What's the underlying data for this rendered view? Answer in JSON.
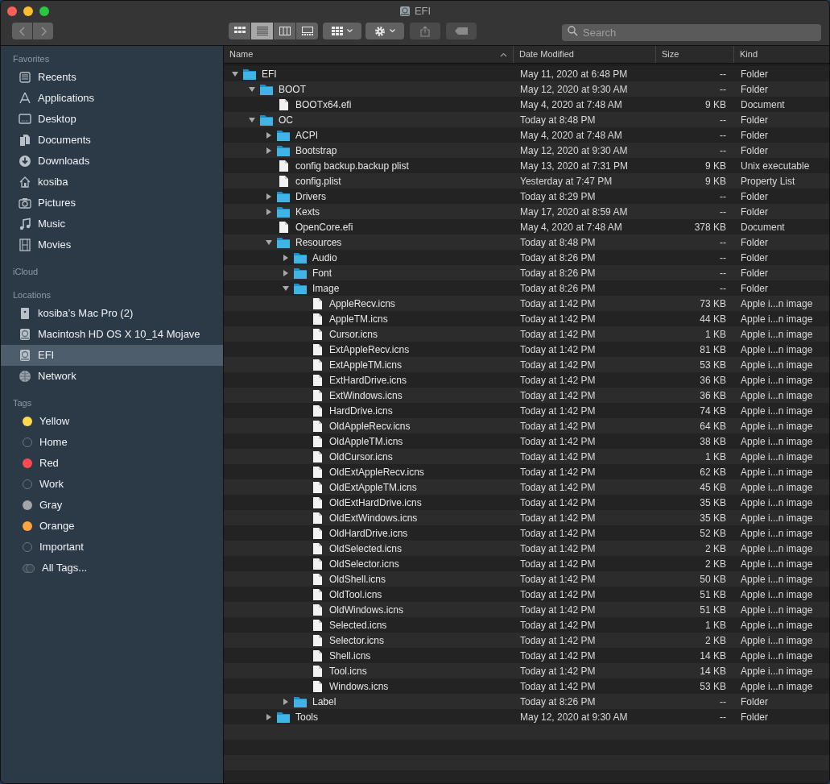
{
  "window": {
    "title": "EFI"
  },
  "toolbar": {
    "views": [
      {
        "selected": false
      },
      {
        "selected": true
      },
      {
        "selected": false
      },
      {
        "selected": false
      }
    ],
    "search": {
      "placeholder": "Search"
    }
  },
  "sidebar": {
    "sections": [
      {
        "heading": "Favorites",
        "items": [
          {
            "label": "Recents",
            "selected": false
          },
          {
            "label": "Applications",
            "selected": false
          },
          {
            "label": "Desktop",
            "selected": false
          },
          {
            "label": "Documents",
            "selected": false
          },
          {
            "label": "Downloads",
            "selected": false
          },
          {
            "label": "kosiba",
            "selected": false
          },
          {
            "label": "Pictures",
            "selected": false
          },
          {
            "label": "Music",
            "selected": false
          },
          {
            "label": "Movies",
            "selected": false
          }
        ]
      },
      {
        "heading": "iCloud"
      },
      {
        "heading": "Locations",
        "items": [
          {
            "label": "kosiba’s Mac Pro (2)",
            "selected": false
          },
          {
            "label": "Macintosh HD OS X 10_14 Mojave",
            "selected": false
          },
          {
            "label": "EFI",
            "selected": true
          },
          {
            "label": "Network",
            "selected": false
          }
        ]
      }
    ],
    "tags_heading": "Tags",
    "tags": [
      {
        "label": "Yellow",
        "kind": "tag",
        "color": "#fedb4d"
      },
      {
        "label": "Home",
        "kind": "tag"
      },
      {
        "label": "Red",
        "kind": "tag",
        "color": "#fd4a52"
      },
      {
        "label": "Work",
        "kind": "tag"
      },
      {
        "label": "Gray",
        "kind": "tag",
        "color": "#a5a5a8"
      },
      {
        "label": "Orange",
        "kind": "tag",
        "color": "#fea541"
      },
      {
        "label": "Important",
        "kind": "tag"
      },
      {
        "label": "All Tags...",
        "kind": "all"
      }
    ]
  },
  "table": {
    "columns": [
      "Name",
      "Date Modified",
      "Size",
      "Kind"
    ],
    "rows": [
      {
        "kind": "folder",
        "expanded": true,
        "name": "EFI",
        "date": "May 11, 2020 at 6:48 PM",
        "size": "--",
        "type": "Folder",
        "children": [
          {
            "kind": "folder",
            "expanded": true,
            "name": "BOOT",
            "date": "May 12, 2020 at 9:30 AM",
            "size": "--",
            "type": "Folder",
            "children": [
              {
                "kind": "file",
                "name": "BOOTx64.efi",
                "date": "May 4, 2020 at 7:48 AM",
                "size": "9 KB",
                "type": "Document"
              }
            ]
          },
          {
            "kind": "folder",
            "expanded": true,
            "name": "OC",
            "date": "Today at 8:48 PM",
            "size": "--",
            "type": "Folder",
            "children": [
              {
                "kind": "folder",
                "expanded": false,
                "name": "ACPI",
                "date": "May 4, 2020 at 7:48 AM",
                "size": "--",
                "type": "Folder"
              },
              {
                "kind": "folder",
                "expanded": false,
                "name": "Bootstrap",
                "date": "May 12, 2020 at 9:30 AM",
                "size": "--",
                "type": "Folder"
              },
              {
                "kind": "file",
                "name": "config backup.backup plist",
                "date": "May 13, 2020 at 7:31 PM",
                "size": "9 KB",
                "type": "Unix executable"
              },
              {
                "kind": "file",
                "name": "config.plist",
                "date": "Yesterday at 7:47 PM",
                "size": "9 KB",
                "type": "Property List"
              },
              {
                "kind": "folder",
                "expanded": false,
                "name": "Drivers",
                "date": "Today at 8:29 PM",
                "size": "--",
                "type": "Folder"
              },
              {
                "kind": "folder",
                "expanded": false,
                "name": "Kexts",
                "date": "May 17, 2020 at 8:59 AM",
                "size": "--",
                "type": "Folder"
              },
              {
                "kind": "file",
                "name": "OpenCore.efi",
                "date": "May 4, 2020 at 7:48 AM",
                "size": "378 KB",
                "type": "Document"
              },
              {
                "kind": "folder",
                "expanded": true,
                "name": "Resources",
                "date": "Today at 8:48 PM",
                "size": "--",
                "type": "Folder",
                "children": [
                  {
                    "kind": "folder",
                    "expanded": false,
                    "name": "Audio",
                    "date": "Today at 8:26 PM",
                    "size": "--",
                    "type": "Folder"
                  },
                  {
                    "kind": "folder",
                    "expanded": false,
                    "name": "Font",
                    "date": "Today at 8:26 PM",
                    "size": "--",
                    "type": "Folder"
                  },
                  {
                    "kind": "folder",
                    "expanded": true,
                    "name": "Image",
                    "date": "Today at 8:26 PM",
                    "size": "--",
                    "type": "Folder",
                    "children": [
                      {
                        "kind": "file",
                        "name": "AppleRecv.icns",
                        "date": "Today at 1:42 PM",
                        "size": "73 KB",
                        "type": "Apple i...n image"
                      },
                      {
                        "kind": "file",
                        "name": "AppleTM.icns",
                        "date": "Today at 1:42 PM",
                        "size": "44 KB",
                        "type": "Apple i...n image"
                      },
                      {
                        "kind": "file",
                        "name": "Cursor.icns",
                        "date": "Today at 1:42 PM",
                        "size": "1 KB",
                        "type": "Apple i...n image"
                      },
                      {
                        "kind": "file",
                        "name": "ExtAppleRecv.icns",
                        "date": "Today at 1:42 PM",
                        "size": "81 KB",
                        "type": "Apple i...n image"
                      },
                      {
                        "kind": "file",
                        "name": "ExtAppleTM.icns",
                        "date": "Today at 1:42 PM",
                        "size": "53 KB",
                        "type": "Apple i...n image"
                      },
                      {
                        "kind": "file",
                        "name": "ExtHardDrive.icns",
                        "date": "Today at 1:42 PM",
                        "size": "36 KB",
                        "type": "Apple i...n image"
                      },
                      {
                        "kind": "file",
                        "name": "ExtWindows.icns",
                        "date": "Today at 1:42 PM",
                        "size": "36 KB",
                        "type": "Apple i...n image"
                      },
                      {
                        "kind": "file",
                        "name": "HardDrive.icns",
                        "date": "Today at 1:42 PM",
                        "size": "74 KB",
                        "type": "Apple i...n image"
                      },
                      {
                        "kind": "file",
                        "name": "OldAppleRecv.icns",
                        "date": "Today at 1:42 PM",
                        "size": "64 KB",
                        "type": "Apple i...n image"
                      },
                      {
                        "kind": "file",
                        "name": "OldAppleTM.icns",
                        "date": "Today at 1:42 PM",
                        "size": "38 KB",
                        "type": "Apple i...n image"
                      },
                      {
                        "kind": "file",
                        "name": "OldCursor.icns",
                        "date": "Today at 1:42 PM",
                        "size": "1 KB",
                        "type": "Apple i...n image"
                      },
                      {
                        "kind": "file",
                        "name": "OldExtAppleRecv.icns",
                        "date": "Today at 1:42 PM",
                        "size": "62 KB",
                        "type": "Apple i...n image"
                      },
                      {
                        "kind": "file",
                        "name": "OldExtAppleTM.icns",
                        "date": "Today at 1:42 PM",
                        "size": "45 KB",
                        "type": "Apple i...n image"
                      },
                      {
                        "kind": "file",
                        "name": "OldExtHardDrive.icns",
                        "date": "Today at 1:42 PM",
                        "size": "35 KB",
                        "type": "Apple i...n image"
                      },
                      {
                        "kind": "file",
                        "name": "OldExtWindows.icns",
                        "date": "Today at 1:42 PM",
                        "size": "35 KB",
                        "type": "Apple i...n image"
                      },
                      {
                        "kind": "file",
                        "name": "OldHardDrive.icns",
                        "date": "Today at 1:42 PM",
                        "size": "52 KB",
                        "type": "Apple i...n image"
                      },
                      {
                        "kind": "file",
                        "name": "OldSelected.icns",
                        "date": "Today at 1:42 PM",
                        "size": "2 KB",
                        "type": "Apple i...n image"
                      },
                      {
                        "kind": "file",
                        "name": "OldSelector.icns",
                        "date": "Today at 1:42 PM",
                        "size": "2 KB",
                        "type": "Apple i...n image"
                      },
                      {
                        "kind": "file",
                        "name": "OldShell.icns",
                        "date": "Today at 1:42 PM",
                        "size": "50 KB",
                        "type": "Apple i...n image"
                      },
                      {
                        "kind": "file",
                        "name": "OldTool.icns",
                        "date": "Today at 1:42 PM",
                        "size": "51 KB",
                        "type": "Apple i...n image"
                      },
                      {
                        "kind": "file",
                        "name": "OldWindows.icns",
                        "date": "Today at 1:42 PM",
                        "size": "51 KB",
                        "type": "Apple i...n image"
                      },
                      {
                        "kind": "file",
                        "name": "Selected.icns",
                        "date": "Today at 1:42 PM",
                        "size": "1 KB",
                        "type": "Apple i...n image"
                      },
                      {
                        "kind": "file",
                        "name": "Selector.icns",
                        "date": "Today at 1:42 PM",
                        "size": "2 KB",
                        "type": "Apple i...n image"
                      },
                      {
                        "kind": "file",
                        "name": "Shell.icns",
                        "date": "Today at 1:42 PM",
                        "size": "14 KB",
                        "type": "Apple i...n image"
                      },
                      {
                        "kind": "file",
                        "name": "Tool.icns",
                        "date": "Today at 1:42 PM",
                        "size": "14 KB",
                        "type": "Apple i...n image"
                      },
                      {
                        "kind": "file",
                        "name": "Windows.icns",
                        "date": "Today at 1:42 PM",
                        "size": "53 KB",
                        "type": "Apple i...n image"
                      }
                    ]
                  },
                  {
                    "kind": "folder",
                    "expanded": false,
                    "name": "Label",
                    "date": "Today at 8:26 PM",
                    "size": "--",
                    "type": "Folder"
                  }
                ]
              },
              {
                "kind": "folder",
                "expanded": false,
                "name": "Tools",
                "date": "May 12, 2020 at 9:30 AM",
                "size": "--",
                "type": "Folder"
              }
            ]
          }
        ]
      }
    ]
  }
}
